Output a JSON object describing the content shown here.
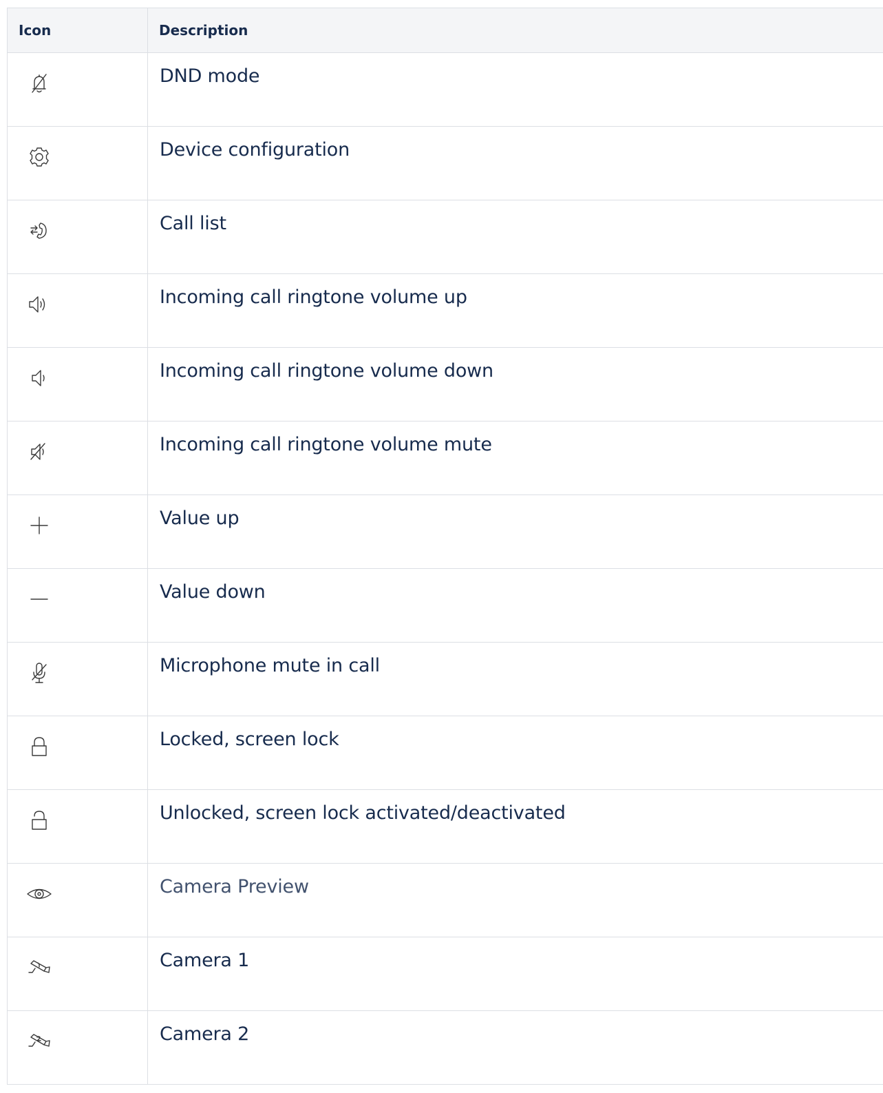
{
  "table": {
    "headers": {
      "icon": "Icon",
      "description": "Description"
    },
    "rows": [
      {
        "icon": "bell-off-icon",
        "description": "DND mode",
        "muted": false
      },
      {
        "icon": "gear-icon",
        "description": "Device configuration",
        "muted": false
      },
      {
        "icon": "call-list-icon",
        "description": "Call list",
        "muted": false
      },
      {
        "icon": "volume-up-icon",
        "description": "Incoming call ringtone volume up",
        "muted": false
      },
      {
        "icon": "volume-down-icon",
        "description": "Incoming call ringtone volume down",
        "muted": false
      },
      {
        "icon": "volume-mute-icon",
        "description": "Incoming call ringtone volume mute",
        "muted": false
      },
      {
        "icon": "plus-icon",
        "description": "Value up",
        "muted": false
      },
      {
        "icon": "minus-icon",
        "description": "Value down",
        "muted": false
      },
      {
        "icon": "microphone-mute-icon",
        "description": "Microphone mute in call",
        "muted": false
      },
      {
        "icon": "lock-icon",
        "description": "Locked, screen lock",
        "muted": false
      },
      {
        "icon": "unlock-icon",
        "description": "Unlocked, screen lock activated/deactivated",
        "muted": false
      },
      {
        "icon": "eye-icon",
        "description": "Camera Preview",
        "muted": true
      },
      {
        "icon": "camera-1-icon",
        "description": "Camera 1",
        "muted": false
      },
      {
        "icon": "camera-2-icon",
        "description": "Camera 2",
        "muted": false
      }
    ]
  },
  "colors": {
    "text": "#172b4d",
    "muted_text": "#42526e",
    "header_bg": "#f4f5f7",
    "border": "#dcdfe4",
    "icon_stroke": "#3a3a3a"
  }
}
